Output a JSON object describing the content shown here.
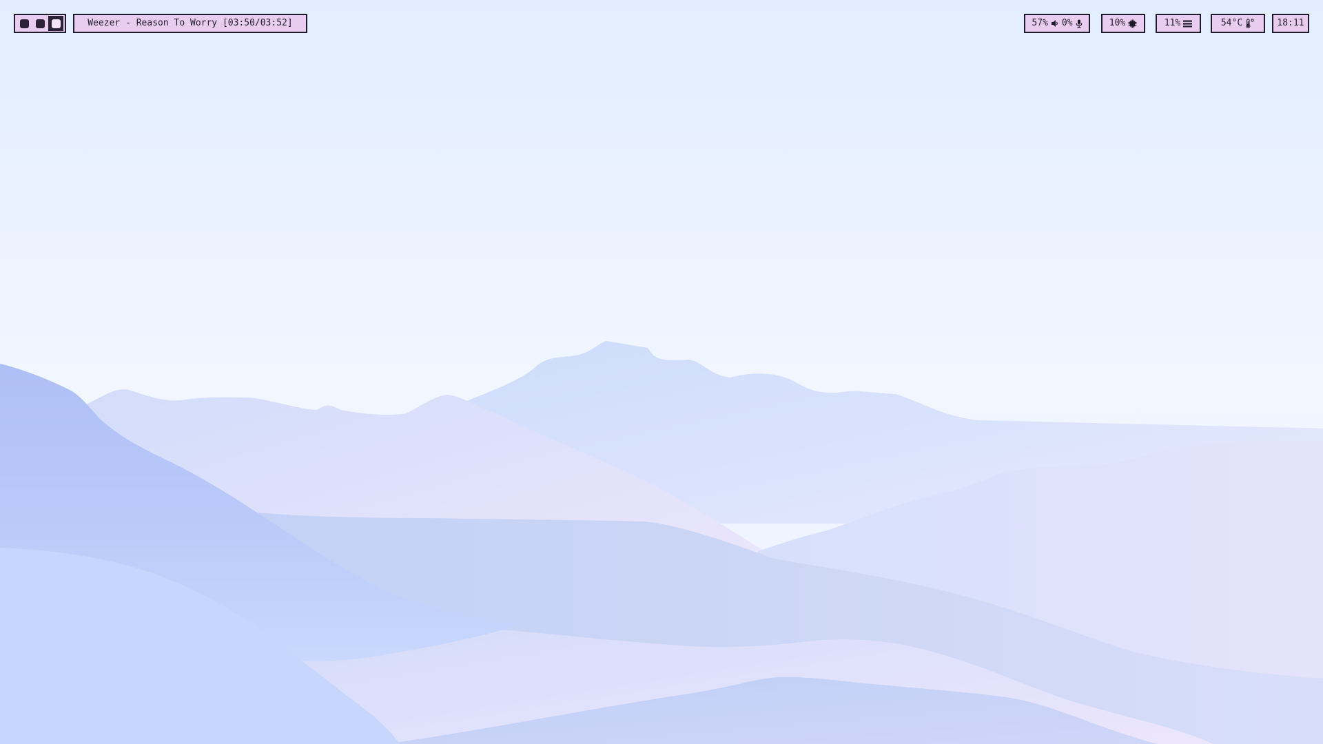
{
  "bar": {
    "workspaces": [
      {
        "label": "workspace 1",
        "active": false
      },
      {
        "label": "workspace 2",
        "active": false
      },
      {
        "label": "workspace 3",
        "active": true
      }
    ],
    "now_playing": "Weezer - Reason To Worry [03:50/03:52]",
    "audio": {
      "volume": "57%",
      "volume_icon": "speaker-icon",
      "mic": "0%",
      "mic_icon": "microphone-icon"
    },
    "cpu": {
      "value": "10%",
      "icon": "cpu-chip-icon"
    },
    "memory": {
      "value": "11%",
      "icon": "memory-bars-icon"
    },
    "temperature": {
      "value": "54°C",
      "icon": "thermometer-icon"
    },
    "clock": "18:11"
  },
  "colors": {
    "module_bg": "#e9cdf1",
    "module_border": "#1f1a2c",
    "text": "#1f1a2c",
    "sky_top": "#e3eeff",
    "sky_horizon": "#f1f6ff",
    "hills": "#b4c6f6"
  }
}
